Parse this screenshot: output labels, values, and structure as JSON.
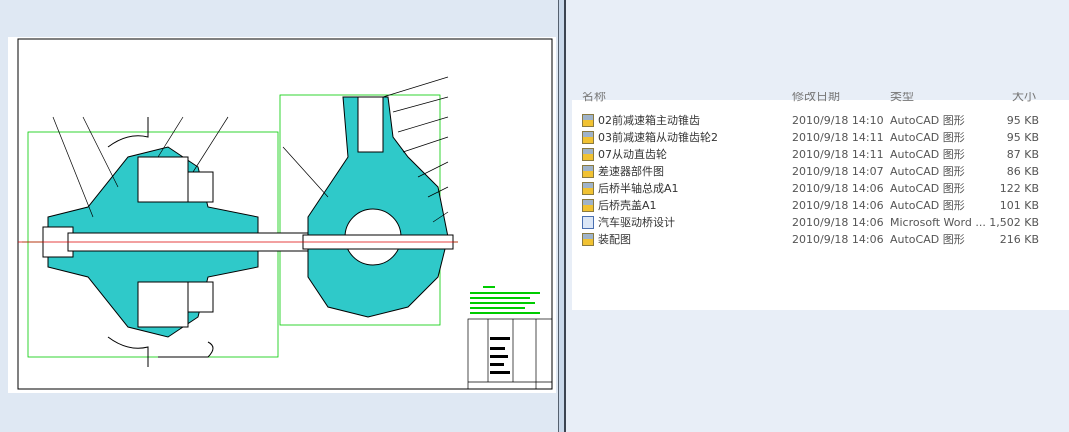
{
  "headers": {
    "name": "名称",
    "date": "修改日期",
    "type": "类型",
    "size": "大小"
  },
  "files": [
    {
      "name": "02前减速箱主动锥齿",
      "date": "2010/9/18 14:10",
      "type": "AutoCAD 图形",
      "size": "95 KB",
      "icon": "autocad-file-icon"
    },
    {
      "name": "03前减速箱从动锥齿轮2",
      "date": "2010/9/18 14:11",
      "type": "AutoCAD 图形",
      "size": "95 KB",
      "icon": "autocad-file-icon"
    },
    {
      "name": "07从动直齿轮",
      "date": "2010/9/18 14:11",
      "type": "AutoCAD 图形",
      "size": "87 KB",
      "icon": "autocad-file-icon"
    },
    {
      "name": "差速器部件图",
      "date": "2010/9/18 14:07",
      "type": "AutoCAD 图形",
      "size": "86 KB",
      "icon": "autocad-file-icon"
    },
    {
      "name": "后桥半轴总成A1",
      "date": "2010/9/18 14:06",
      "type": "AutoCAD 图形",
      "size": "122 KB",
      "icon": "autocad-file-icon"
    },
    {
      "name": "后桥壳盖A1",
      "date": "2010/9/18 14:06",
      "type": "AutoCAD 图形",
      "size": "101 KB",
      "icon": "autocad-file-icon"
    },
    {
      "name": "汽车驱动桥设计",
      "date": "2010/9/18 14:06",
      "type": "Microsoft Word ...",
      "size": "1,502 KB",
      "icon": "word-file-icon"
    },
    {
      "name": "装配图",
      "date": "2010/9/18 14:06",
      "type": "AutoCAD 图形",
      "size": "216 KB",
      "icon": "autocad-file-icon"
    }
  ]
}
